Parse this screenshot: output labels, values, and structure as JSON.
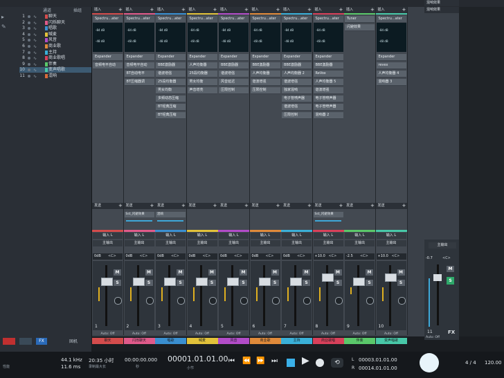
{
  "track_list": {
    "header_col1": "通道",
    "header_col2": "插组",
    "tracks": [
      {
        "num": "1",
        "name": "聊天",
        "color": "#d44c4c"
      },
      {
        "num": "2",
        "name": "闪烁聊天",
        "color": "#e05a8a"
      },
      {
        "num": "3",
        "name": "唱歌",
        "color": "#3a8fd0"
      },
      {
        "num": "4",
        "name": "喊麦",
        "color": "#e2c23a"
      },
      {
        "num": "5",
        "name": "风音",
        "color": "#b24cc8"
      },
      {
        "num": "6",
        "name": "商业歌",
        "color": "#e08a3a"
      },
      {
        "num": "7",
        "name": "主持",
        "color": "#3ab0d8"
      },
      {
        "num": "8",
        "name": "商业歌唱",
        "color": "#d8405a"
      },
      {
        "num": "9",
        "name": "伴奏",
        "color": "#5ac86a"
      },
      {
        "num": "10",
        "name": "变声唱歌",
        "color": "#48c8a8"
      },
      {
        "num": "11",
        "name": "混响",
        "color": "#d86a3a"
      }
    ]
  },
  "channels": [
    {
      "insert": "插入",
      "color": "#d44c4c",
      "meter_top": "-84 dB",
      "meter_bot": "-48 dB",
      "plugins": [
        "Spectru...ater",
        "Expander",
        "音频电平自动"
      ],
      "send": "发送",
      "io1": "输入 L",
      "io2": "主输出",
      "gain": "0dB",
      "pan": "<C>",
      "num": "1",
      "auto": "Auto: Off",
      "name": "聊天",
      "sendslot": ""
    },
    {
      "insert": "插入",
      "color": "#e05a8a",
      "meter_top": "-84 dB",
      "meter_bot": "-48 dB",
      "plugins": [
        "Spectru...ater",
        "Expander",
        "音频电平自动",
        "BT自动电平",
        "BT压缩器调"
      ],
      "send": "发送",
      "io1": "输入 L",
      "io2": "主输出",
      "gain": "0dB",
      "pan": "<C>",
      "num": "2",
      "auto": "Auto: Off",
      "name": "闪烁聊天",
      "sendslot": "Sst_闪避效果"
    },
    {
      "insert": "插入",
      "color": "#3a8fd0",
      "meter_top": "-84 dB",
      "meter_bot": "-48 dB",
      "plugins": [
        "Spectru...ater",
        "Expander",
        "BBE激励器",
        "谐波增强",
        "25段均衡器",
        "男女均衡",
        "多频动态压缩",
        "BT经典压缩",
        "BT经典压缩"
      ],
      "send": "发送",
      "io1": "输入 L",
      "io2": "主输出",
      "gain": "0dB",
      "pan": "<C>",
      "num": "3",
      "auto": "Auto: Off",
      "name": "唱歌",
      "sendslot": "混响"
    },
    {
      "insert": "插入",
      "color": "#e2c23a",
      "meter_top": "-84 dB",
      "meter_bot": "-48 dB",
      "plugins": [
        "Spectru...ater",
        "Expander",
        "人声均衡器",
        "25段均衡器",
        "男女均衡",
        "声音增亮"
      ],
      "send": "发送",
      "io1": "输入 L",
      "io2": "主输出",
      "gain": "0dB",
      "pan": "<C>",
      "num": "4",
      "auto": "Auto: Off",
      "name": "喊麦",
      "sendslot": ""
    },
    {
      "insert": "插入",
      "color": "#b24cc8",
      "meter_top": "-84 dB",
      "meter_bot": "-48 dB",
      "plugins": [
        "Spectru...ater",
        "Expander",
        "BBE激励器",
        "谐波增强",
        "风音延迟",
        "压限控制"
      ],
      "send": "发送",
      "io1": "输入 L",
      "io2": "主输出",
      "gain": "0dB",
      "pan": "<C>",
      "num": "5",
      "auto": "Auto: Off",
      "name": "风音",
      "sendslot": ""
    },
    {
      "insert": "插入",
      "color": "#e08a3a",
      "meter_top": "-84 dB",
      "meter_bot": "-48 dB",
      "plugins": [
        "Spectru...ater",
        "Expander",
        "BBE激励器",
        "人声均衡器",
        "谐波增强",
        "压限控制"
      ],
      "send": "发送",
      "io1": "输入 L",
      "io2": "主输出",
      "gain": "0dB",
      "pan": "<C>",
      "num": "6",
      "auto": "Auto: Off",
      "name": "商业歌",
      "sendslot": ""
    },
    {
      "insert": "插入",
      "color": "#3ab0d8",
      "meter_top": "-84 dB",
      "meter_bot": "-48 dB",
      "plugins": [
        "Spectru...ater",
        "Expander",
        "BBE激励器",
        "人声均衡器 2",
        "谐波增强",
        "独家混响",
        "电子管喷声器",
        "谐波增强",
        "压限控制"
      ],
      "send": "发送",
      "io1": "输入 L",
      "io2": "主输出",
      "gain": "0dB",
      "pan": "<C>",
      "num": "7",
      "auto": "Auto: Off",
      "name": "主持",
      "sendslot": ""
    },
    {
      "insert": "插入",
      "color": "#d8405a",
      "meter_top": "-84 dB",
      "meter_bot": "-48 dB",
      "plugins": [
        "Spectru...ater",
        "Expander",
        "BBE激励器",
        "ReVox",
        "人声均衡器 5",
        "谐波增强",
        "电子管喷声器",
        "电子管喷声器",
        "混响器 2"
      ],
      "send": "发送",
      "io1": "输入 L",
      "io2": "主输出",
      "gain": "+10.0",
      "pan": "<C>",
      "num": "8",
      "auto": "Auto: Off",
      "name": "商业歌唱",
      "sendslot": "Sst_闪避效果"
    },
    {
      "insert": "插入",
      "color": "#5ac86a",
      "meter_top": "",
      "meter_bot": "",
      "plugins": [
        "Tuner",
        "闪避效果"
      ],
      "send": "发送",
      "io1": "输入 L",
      "io2": "主输出",
      "gain": "-2.5",
      "pan": "<C>",
      "num": "9",
      "auto": "Auto: Off",
      "name": "伴奏",
      "sendslot": ""
    },
    {
      "insert": "插入",
      "color": "#48c8a8",
      "meter_top": "-84 dB",
      "meter_bot": "-48 dB",
      "plugins": [
        "Spectru...ater",
        "Expander",
        "revex",
        "人声均衡器 4",
        "混响器 3"
      ],
      "send": "发送",
      "io1": "输入 L",
      "io2": "主输出",
      "gain": "+10.0",
      "pan": "<C>",
      "num": "10",
      "auto": "Auto: Off",
      "name": "变声唱歌",
      "sendslot": ""
    }
  ],
  "master": {
    "header": "混响效果",
    "io2": "主输出",
    "gain": "-0.7",
    "pan": "<C>",
    "num": "11",
    "label": "FX",
    "auto": "Auto: Off"
  },
  "transport": {
    "sample_rate": "44.1 kHz",
    "latency": "11.6 ms",
    "rec_time": "20:35 小时",
    "rec_label": "录制最大长",
    "time1": "00:00:00.000",
    "time1_label": "秒",
    "position": "00001.01.01.00",
    "position_label": "小节",
    "loop_l": "00003.01.01.00",
    "loop_r": "00014.01.01.00",
    "sig": "4 / 4",
    "tempo": "120.00",
    "perf_label": "性能",
    "left_bottom_label": "固机"
  }
}
